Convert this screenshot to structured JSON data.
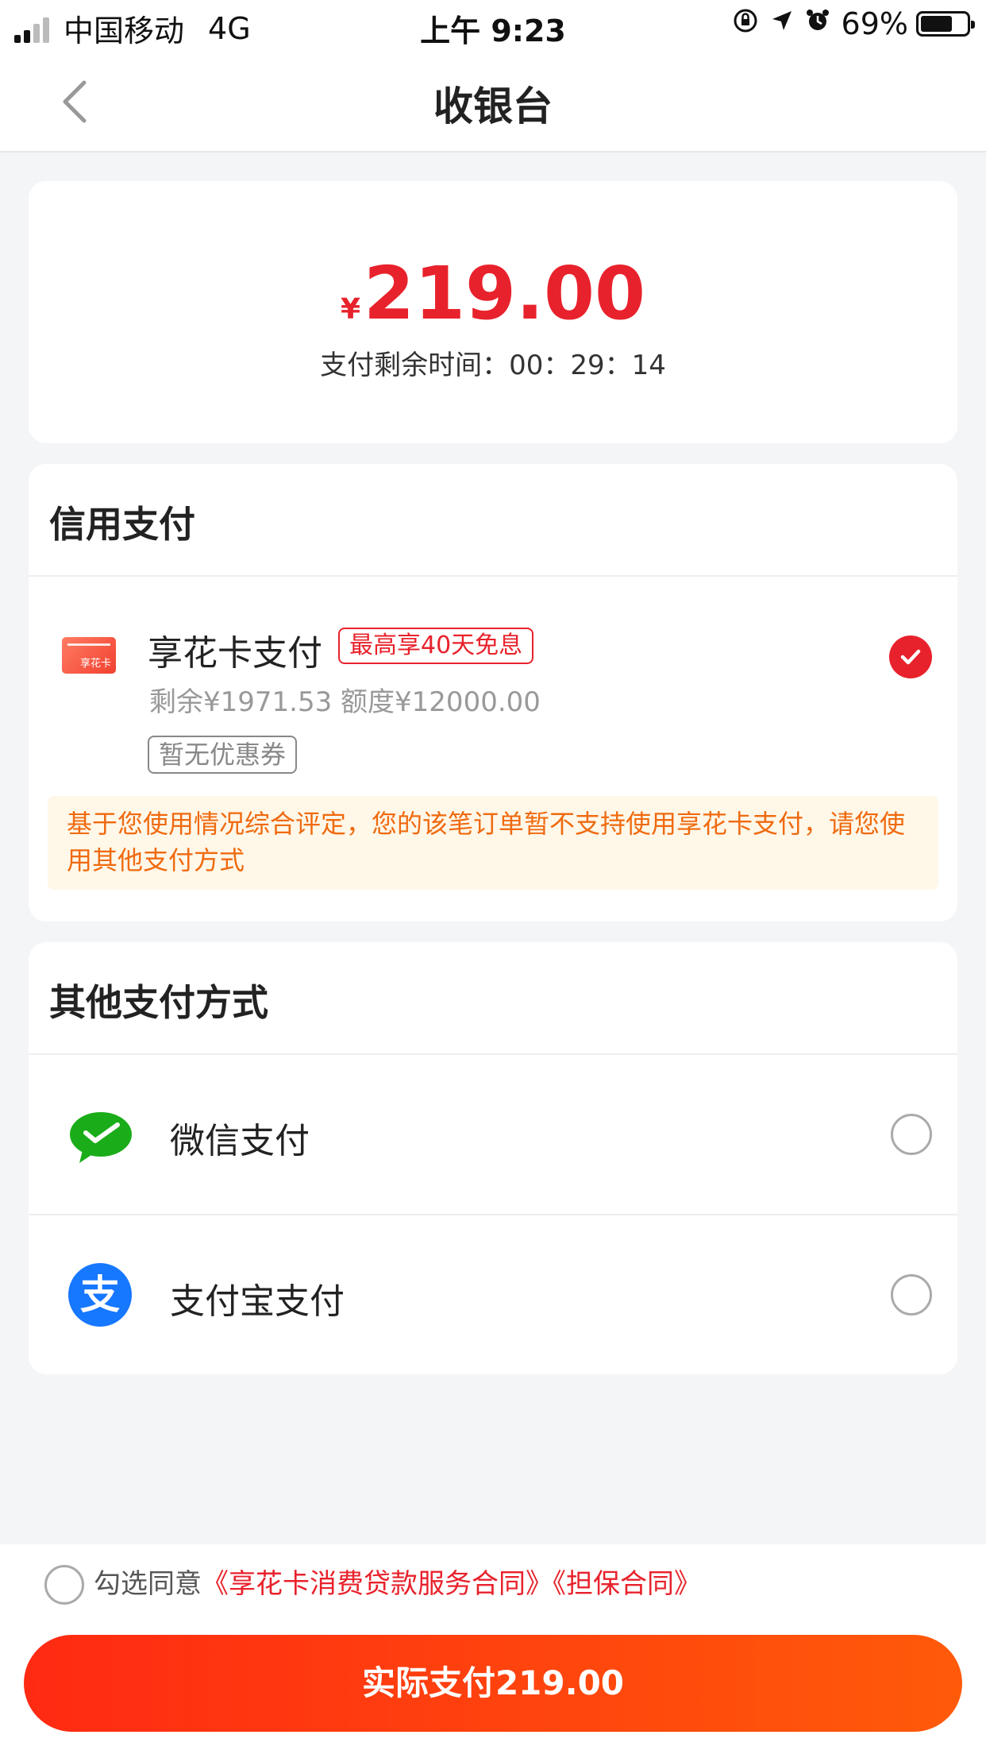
{
  "status_bar": {
    "carrier": "中国移动",
    "network": "4G",
    "time": "上午 9:23",
    "battery": "69%",
    "icons": [
      "orientation-lock-icon",
      "location-icon",
      "alarm-icon",
      "battery-icon"
    ]
  },
  "nav": {
    "title": "收银台",
    "back_icon": "chevron-left-icon"
  },
  "amount": {
    "currency": "¥",
    "value": "219.00",
    "countdown": "支付剩余时间：00：29：14"
  },
  "credit": {
    "section_title": "信用支付",
    "method": {
      "icon_label": "享花卡",
      "name": "享花卡支付",
      "badge": "最高享40天免息",
      "balance": "剩余¥1971.53  额度¥12000.00",
      "coupon": "暂无优惠券",
      "selected": true
    },
    "notice": "基于您使用情况综合评定，您的该笔订单暂不支持使用享花卡支付，请您使用其他支付方式"
  },
  "other": {
    "section_title": "其他支付方式",
    "methods": [
      {
        "name": "微信支付",
        "icon": "wechat-icon",
        "selected": false
      },
      {
        "name": "支付宝支付",
        "icon": "alipay-icon",
        "icon_char": "支",
        "selected": false
      }
    ]
  },
  "footer": {
    "agree_prefix": "勾选同意",
    "agree_link1": "《享花卡消费贷款服务合同》",
    "agree_link2": "《担保合同》",
    "pay_button": "实际支付219.00"
  },
  "colors": {
    "accent": "#e8222c",
    "notice_text": "#ef6a0f",
    "notice_bg": "#fff7e8",
    "button_start": "#ff2a12",
    "button_end": "#ff5a0a"
  }
}
